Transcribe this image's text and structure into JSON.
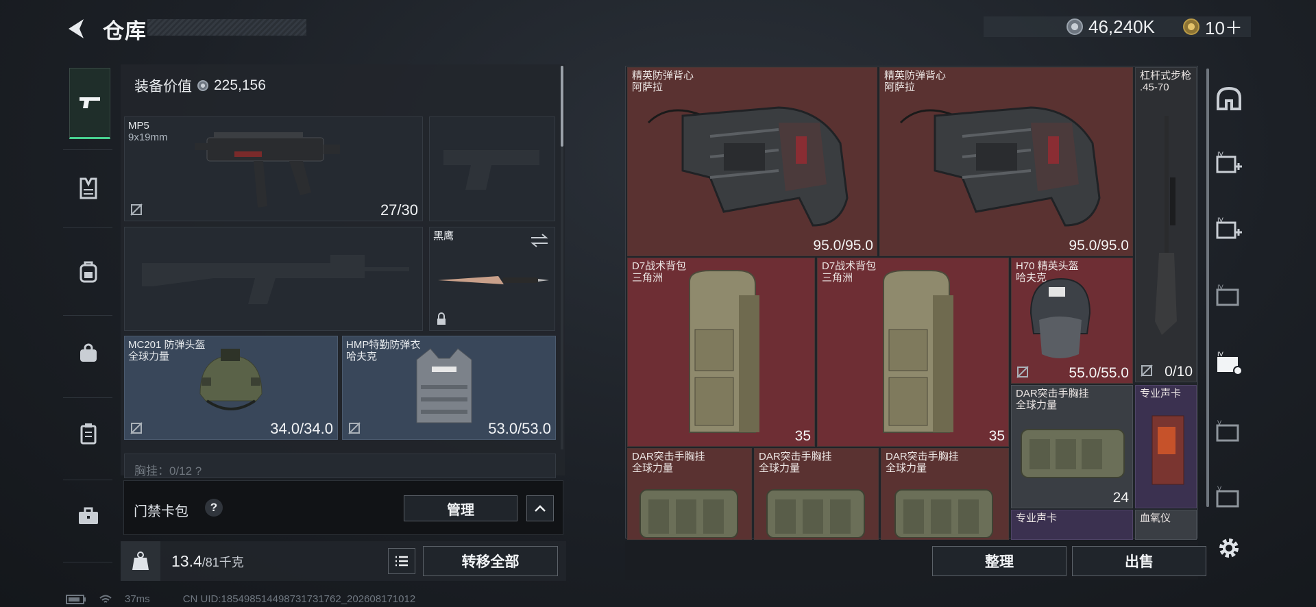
{
  "header": {
    "title": "仓库",
    "currency_amount": "46,240K",
    "premium_amount": "10＋"
  },
  "equipment": {
    "value_label": "装备价值",
    "value": "225,156",
    "primary": {
      "name": "MP5",
      "ammo": "9x19mm",
      "count": "27/30"
    },
    "melee": {
      "name": "黑鹰"
    },
    "helmet": {
      "name": "MC201 防弹头盔",
      "brand": "全球力量",
      "durability": "34.0/34.0"
    },
    "armor": {
      "name": "HMP特勤防弹衣",
      "brand": "哈夫克",
      "durability": "53.0/53.0"
    },
    "chest_rig_partial": "胸挂：0/12  ?",
    "keycard": {
      "label": "门禁卡包",
      "help": "?",
      "manage_label": "管理"
    },
    "weight": {
      "value": "13.4",
      "capacity": "/81千克"
    },
    "transfer_all_label": "转移全部"
  },
  "inventory": [
    {
      "name": "精英防弹背心",
      "brand": "阿萨拉",
      "value": "95.0/95.0"
    },
    {
      "name": "精英防弹背心",
      "brand": "阿萨拉",
      "value": "95.0/95.0"
    },
    {
      "name": "杠杆式步枪",
      "brand": ".45-70"
    },
    {
      "name": "D7战术背包",
      "brand": "三角洲",
      "value": "35"
    },
    {
      "name": "D7战术背包",
      "brand": "三角洲",
      "value": "35"
    },
    {
      "name": "H70 精英头盔",
      "brand": "哈夫克",
      "value": "55.0/55.0"
    },
    {
      "name": "",
      "brand": "",
      "value": "0/10"
    },
    {
      "name": "DAR突击手胸挂",
      "brand": "全球力量",
      "value": "24"
    },
    {
      "name": "专业声卡",
      "brand": ""
    },
    {
      "name": "DAR突击手胸挂",
      "brand": "全球力量"
    },
    {
      "name": "DAR突击手胸挂",
      "brand": "全球力量"
    },
    {
      "name": "DAR突击手胸挂",
      "brand": "全球力量"
    },
    {
      "name": "专业声卡",
      "brand": ""
    },
    {
      "name": "血氧仪",
      "brand": ""
    }
  ],
  "actions": {
    "sort_label": "整理",
    "sell_label": "出售"
  },
  "status": {
    "ping": "37ms",
    "uid": "CN UID:18549851449873173​1762_202608171012"
  },
  "icons": [
    "back-arrow-icon",
    "silver-coin-icon",
    "gold-coin-icon",
    "pistol-icon",
    "vest-icon",
    "backpack-icon",
    "bag-icon",
    "clipboard-icon",
    "toolbox-icon",
    "helmet-outline-icon",
    "add-case-icon",
    "settings-icon",
    "weight-icon",
    "list-icon",
    "chevron-up-icon",
    "swap-icon",
    "lock-icon",
    "no-insure-icon",
    "battery-icon",
    "wifi-icon"
  ],
  "colors": {
    "accent": "#47d08f",
    "item_red": "#5a3231",
    "item_purple": "#3b3150"
  }
}
